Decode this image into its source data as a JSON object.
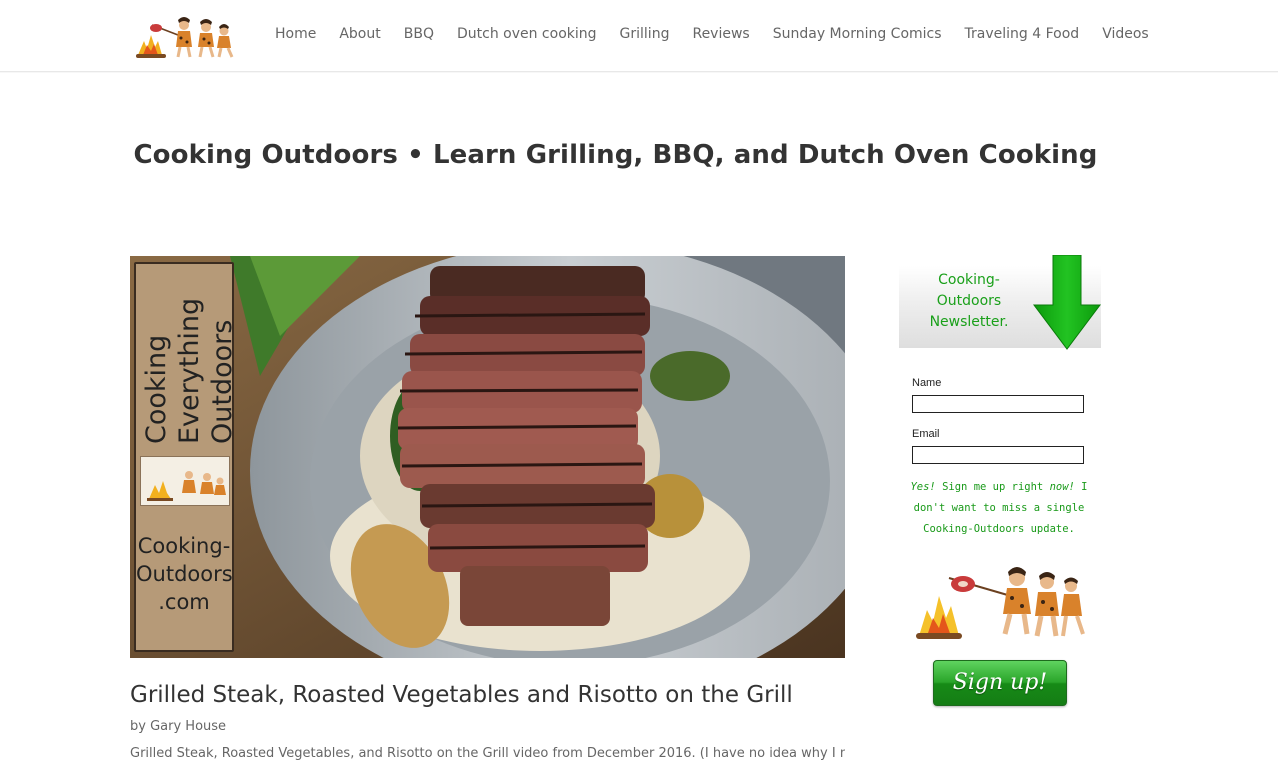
{
  "header": {
    "nav": [
      {
        "label": "Home"
      },
      {
        "label": "About"
      },
      {
        "label": "BBQ"
      },
      {
        "label": "Dutch oven cooking"
      },
      {
        "label": "Grilling"
      },
      {
        "label": "Reviews"
      },
      {
        "label": "Sunday Morning Comics"
      },
      {
        "label": "Traveling 4 Food"
      },
      {
        "label": "Videos"
      }
    ]
  },
  "page": {
    "title": "Cooking Outdoors • Learn Grilling, BBQ, and Dutch Oven Cooking"
  },
  "post": {
    "image": {
      "sign_line1": "Cooking",
      "sign_line2": "Everything",
      "sign_line3": "Outdoors",
      "sign_url_line1": "Cooking-",
      "sign_url_line2": "Outdoors",
      "sign_url_line3": ".com"
    },
    "title": "Grilled Steak, Roasted Vegetables and Risotto on the Grill",
    "byline_prefix": "by ",
    "author": "Gary House",
    "excerpt": "Grilled Steak, Roasted Vegetables, and Risotto on the Grill video from December 2016. (I have no idea why I never shared"
  },
  "sidebar": {
    "newsletter_line1": "Cooking-",
    "newsletter_line2": "Outdoors",
    "newsletter_line3": "Newsletter.",
    "name_label": "Name",
    "name_value": "",
    "email_label": "Email",
    "email_value": "",
    "note_italic1": "Yes!",
    "note_part1": " Sign me up right ",
    "note_italic2": "now!",
    "note_part2": " I",
    "note_line2": "don't want to miss a single",
    "note_line3": "Cooking-Outdoors update.",
    "signup_label": "Sign up!"
  },
  "colors": {
    "accent_green": "#1aa01a",
    "arrow_green": "#12b012",
    "nav_text": "#666666",
    "title_text": "#333333"
  },
  "icons": [
    "caveman-logo",
    "green-down-arrow-icon",
    "cavemen-campfire-illustration"
  ]
}
